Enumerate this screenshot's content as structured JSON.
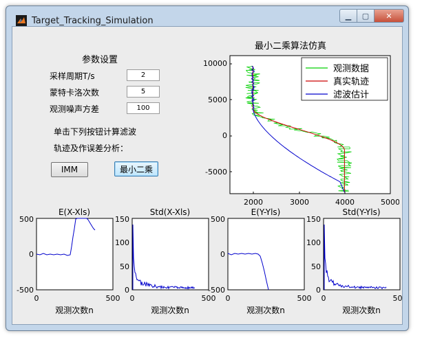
{
  "window": {
    "title": "Target_Tracking_Simulation"
  },
  "params": {
    "heading": "参数设置",
    "sample_period_label": "采样周期T/s",
    "sample_period_value": "2",
    "mc_runs_label": "蒙特卡洛次数",
    "mc_runs_value": "5",
    "noise_var_label": "观测噪声方差",
    "noise_var_value": "100"
  },
  "instructions": {
    "line1": "单击下列按钮计算滤波",
    "line2": "轨迹及作误差分析："
  },
  "buttons": {
    "imm": "IMM",
    "least_squares": "最小二乘"
  },
  "main_plot": {
    "title": "最小二乘算法仿真",
    "x_ticks": [
      "2000",
      "3000",
      "4000",
      "5000"
    ],
    "y_ticks": [
      "10000",
      "5000",
      "0",
      "-5000"
    ],
    "legend": [
      "观测数据",
      "真实轨迹",
      "滤波估计"
    ],
    "colors": {
      "observed": "#00d000",
      "true": "#cc0000",
      "estimate": "#0000cc"
    }
  },
  "small_plots": [
    {
      "title": "E(X-Xls)",
      "y_ticks": [
        "500",
        "0",
        "-500"
      ],
      "x_ticks": [
        "0",
        "500"
      ],
      "xlabel": "观测次数n"
    },
    {
      "title": "Std(X-Xls)",
      "y_ticks": [
        "150",
        "100",
        "50",
        "0"
      ],
      "x_ticks": [
        "0",
        "500"
      ],
      "xlabel": "观测次数n"
    },
    {
      "title": "E(Y-Yls)",
      "y_ticks": [
        "500",
        "0",
        "-500"
      ],
      "x_ticks": [
        "0",
        "500"
      ],
      "xlabel": "观测次数n"
    },
    {
      "title": "Std(Y-Yls)",
      "y_ticks": [
        "150",
        "100",
        "50",
        "0"
      ],
      "x_ticks": [
        "0",
        "500"
      ],
      "xlabel": "观测次数n"
    }
  ]
}
